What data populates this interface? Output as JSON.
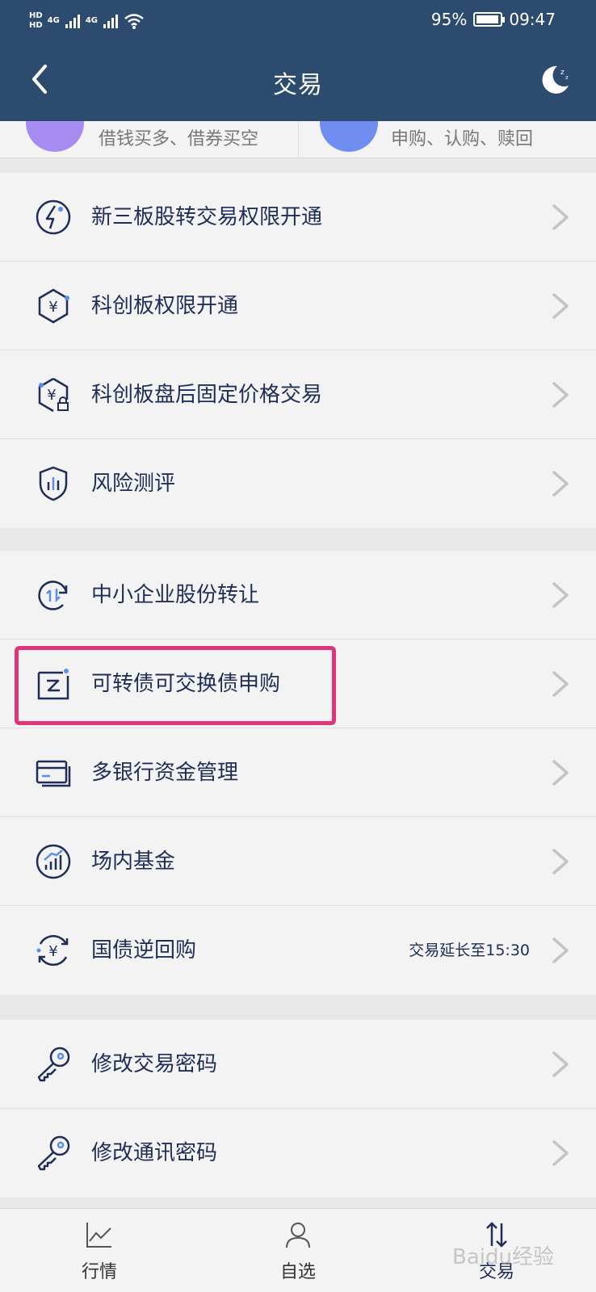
{
  "status_bar": {
    "hd1": "HD",
    "hd2": "HD",
    "sig1": "4G",
    "sig2": "4G",
    "battery": "95%",
    "battery_level": 0.95,
    "time": "09:47"
  },
  "header": {
    "title": "交易"
  },
  "shortcuts": [
    {
      "text": "借钱买多、借券买空",
      "color": "#a78bf0"
    },
    {
      "text": "申购、认购、赎回",
      "color": "#6f8ef0"
    }
  ],
  "groups": [
    {
      "items": [
        {
          "label": "新三板股转交易权限开通",
          "icon": "lightning-circle-icon"
        },
        {
          "label": "科创板权限开通",
          "icon": "yuan-hexagon-icon"
        },
        {
          "label": "科创板盘后固定价格交易",
          "icon": "yuan-hexagon-lock-icon"
        },
        {
          "label": "风险测评",
          "icon": "shield-chart-icon"
        }
      ]
    },
    {
      "items": [
        {
          "label": "中小企业股份转让",
          "icon": "transfer-cycle-icon"
        },
        {
          "label": "可转债可交换债申购",
          "icon": "bond-document-icon"
        },
        {
          "label": "多银行资金管理",
          "icon": "bank-cards-icon"
        },
        {
          "label": "场内基金",
          "icon": "growth-chart-icon"
        },
        {
          "label": "国债逆回购",
          "icon": "yuan-refresh-icon",
          "note": "交易延长至15:30"
        }
      ]
    },
    {
      "items": [
        {
          "label": "修改交易密码",
          "icon": "key-icon"
        },
        {
          "label": "修改通讯密码",
          "icon": "key-icon"
        }
      ]
    }
  ],
  "tabs": [
    {
      "label": "行情",
      "icon": "line-chart-icon"
    },
    {
      "label": "自选",
      "icon": "person-icon"
    },
    {
      "label": "交易",
      "icon": "exchange-arrows-icon"
    }
  ],
  "watermark": "Baidu经验",
  "colors": {
    "header": "#2d4a6f",
    "highlight": "#e0357a",
    "text": "#1f2d57"
  }
}
